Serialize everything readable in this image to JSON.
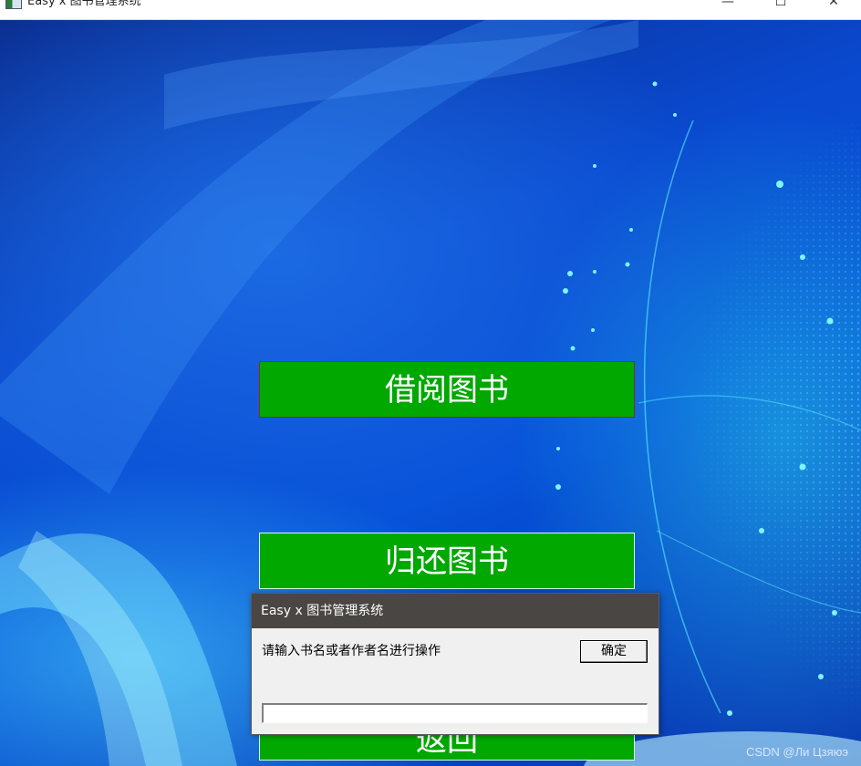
{
  "window": {
    "title": "Easy x 图书管理系统",
    "minimize_glyph": "—",
    "maximize_glyph": "☐",
    "close_glyph": "✕"
  },
  "menu": {
    "borrow_label": "借阅图书",
    "return_label": "归还图书",
    "back_label": "返回"
  },
  "dialog": {
    "title": "Easy x 图书管理系统",
    "prompt": "请输入书名或者作者名进行操作",
    "ok_label": "确定",
    "input_value": ""
  },
  "watermark": "CSDN @Ли Цзяюэ",
  "colors": {
    "button_green": "#00a800",
    "dialog_title_bg": "#4a4644"
  }
}
